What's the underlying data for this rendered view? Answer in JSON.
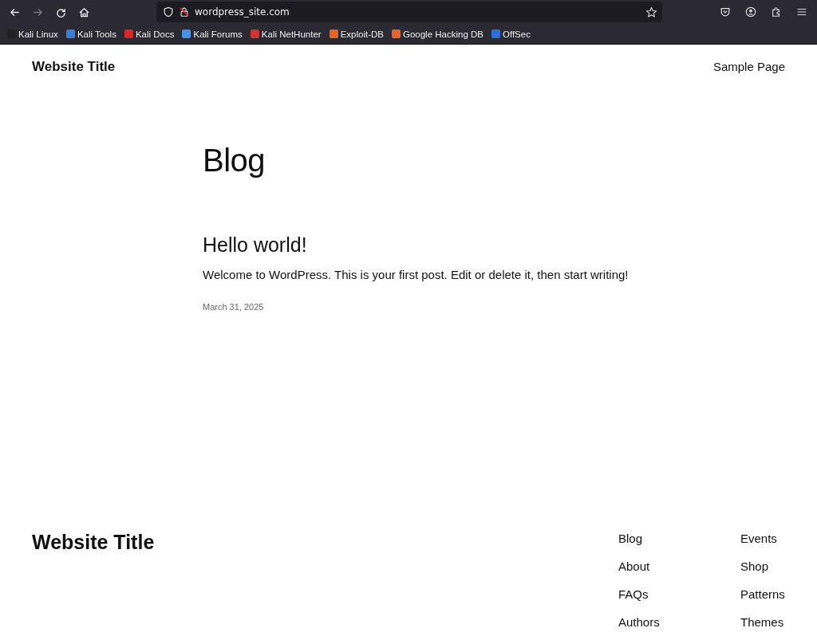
{
  "browser": {
    "nav_buttons": [
      {
        "kind": "back",
        "disabled": false
      },
      {
        "kind": "forward",
        "disabled": true
      },
      {
        "kind": "reload",
        "disabled": false
      },
      {
        "kind": "home",
        "disabled": false
      }
    ],
    "address": "wordpress_site.com",
    "bookmarks": [
      {
        "label": "Kali Linux",
        "color": "#222222"
      },
      {
        "label": "Kali Tools",
        "color": "#3a7bd5"
      },
      {
        "label": "Kali Docs",
        "color": "#d22a2a"
      },
      {
        "label": "Kali Forums",
        "color": "#4a90e2"
      },
      {
        "label": "Kali NetHunter",
        "color": "#cc3333"
      },
      {
        "label": "Exploit-DB",
        "color": "#e8622c"
      },
      {
        "label": "Google Hacking DB",
        "color": "#e8622c"
      },
      {
        "label": "OffSec",
        "color": "#2d6fd6"
      }
    ]
  },
  "header": {
    "site_title": "Website Title",
    "nav": [
      "Sample Page"
    ]
  },
  "main": {
    "heading": "Blog",
    "posts": [
      {
        "title": "Hello world!",
        "excerpt": "Welcome to WordPress. This is your first post. Edit or delete it, then start writing!",
        "date": "March 31, 2025"
      }
    ]
  },
  "footer": {
    "site_title": "Website Title",
    "nav_columns": [
      [
        "Blog",
        "About",
        "FAQs",
        "Authors"
      ],
      [
        "Events",
        "Shop",
        "Patterns",
        "Themes"
      ]
    ]
  }
}
